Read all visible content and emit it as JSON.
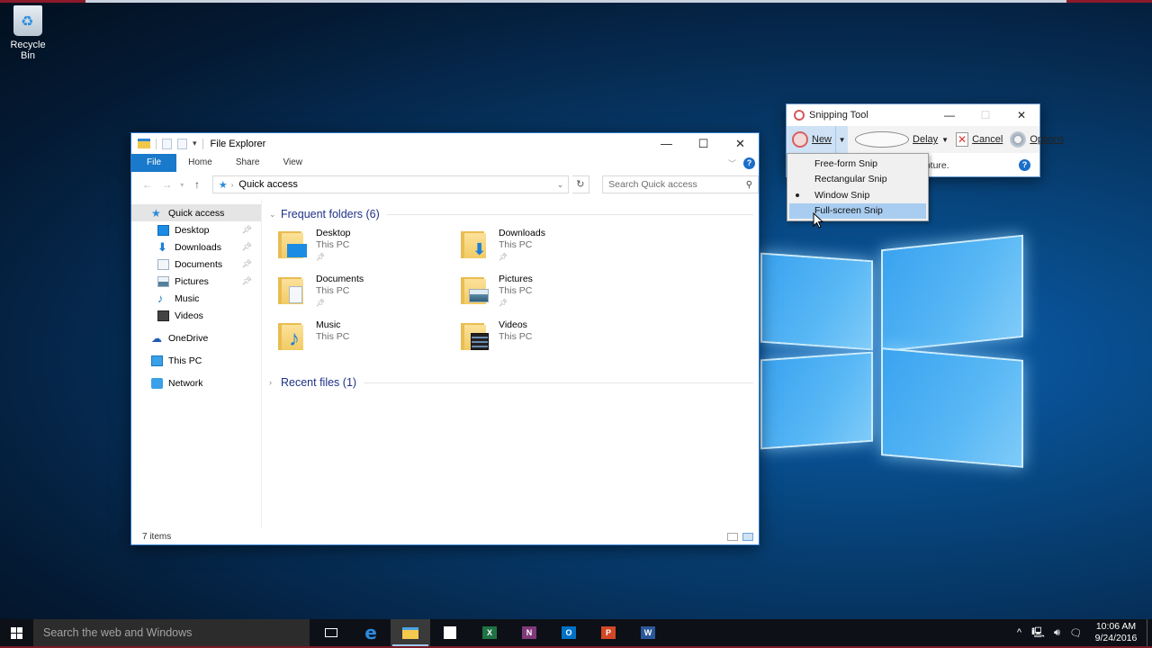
{
  "desktop": {
    "recycle_bin_label": "Recycle Bin"
  },
  "explorer": {
    "title": "File Explorer",
    "window_controls": {
      "minimize": "—",
      "maximize": "☐",
      "close": "✕"
    },
    "ribbon_tabs": [
      "File",
      "Home",
      "Share",
      "View"
    ],
    "address": {
      "icon": "quick-access-star-icon",
      "path": "Quick access"
    },
    "search_placeholder": "Search Quick access",
    "nav": {
      "quick_access": "Quick access",
      "pinned": [
        {
          "label": "Desktop",
          "icon": "desktop-icon",
          "pinned": true
        },
        {
          "label": "Downloads",
          "icon": "downloads-icon",
          "pinned": true
        },
        {
          "label": "Documents",
          "icon": "documents-icon",
          "pinned": true
        },
        {
          "label": "Pictures",
          "icon": "pictures-icon",
          "pinned": true
        },
        {
          "label": "Music",
          "icon": "music-icon",
          "pinned": false
        },
        {
          "label": "Videos",
          "icon": "videos-icon",
          "pinned": false
        }
      ],
      "onedrive": "OneDrive",
      "this_pc": "This PC",
      "network": "Network"
    },
    "frequent_header": "Frequent folders (6)",
    "frequent_folders": [
      {
        "name": "Desktop",
        "location": "This PC",
        "pinned": true
      },
      {
        "name": "Downloads",
        "location": "This PC",
        "pinned": true
      },
      {
        "name": "Documents",
        "location": "This PC",
        "pinned": true
      },
      {
        "name": "Pictures",
        "location": "This PC",
        "pinned": true
      },
      {
        "name": "Music",
        "location": "This PC",
        "pinned": false
      },
      {
        "name": "Videos",
        "location": "This PC",
        "pinned": false
      }
    ],
    "recent_header": "Recent files (1)",
    "status": "7 items"
  },
  "snipping_tool": {
    "title": "Snipping Tool",
    "toolbar": {
      "new": "New",
      "delay": "Delay",
      "cancel": "Cancel",
      "options": "Options"
    },
    "message_fragment": "apture.",
    "menu": [
      {
        "label": "Free-form Snip",
        "selected": false,
        "highlighted": false
      },
      {
        "label": "Rectangular Snip",
        "selected": false,
        "highlighted": false
      },
      {
        "label": "Window Snip",
        "selected": true,
        "highlighted": false
      },
      {
        "label": "Full-screen Snip",
        "selected": false,
        "highlighted": true
      }
    ]
  },
  "taskbar": {
    "search_placeholder": "Search the web and Windows",
    "apps": [
      "Task View",
      "Microsoft Edge",
      "File Explorer",
      "Store",
      "Excel",
      "OneNote",
      "Outlook",
      "PowerPoint",
      "Word"
    ],
    "app_letters": {
      "excel": "X",
      "onenote": "N",
      "outlook": "O",
      "powerpoint": "P",
      "word": "W"
    },
    "colors": {
      "excel": "#1f7244",
      "onenote": "#80397b",
      "outlook": "#0072c6",
      "powerpoint": "#d24726",
      "word": "#2b579a",
      "edge": "#2b8ae0"
    },
    "time": "10:06 AM",
    "date": "9/24/2016"
  }
}
